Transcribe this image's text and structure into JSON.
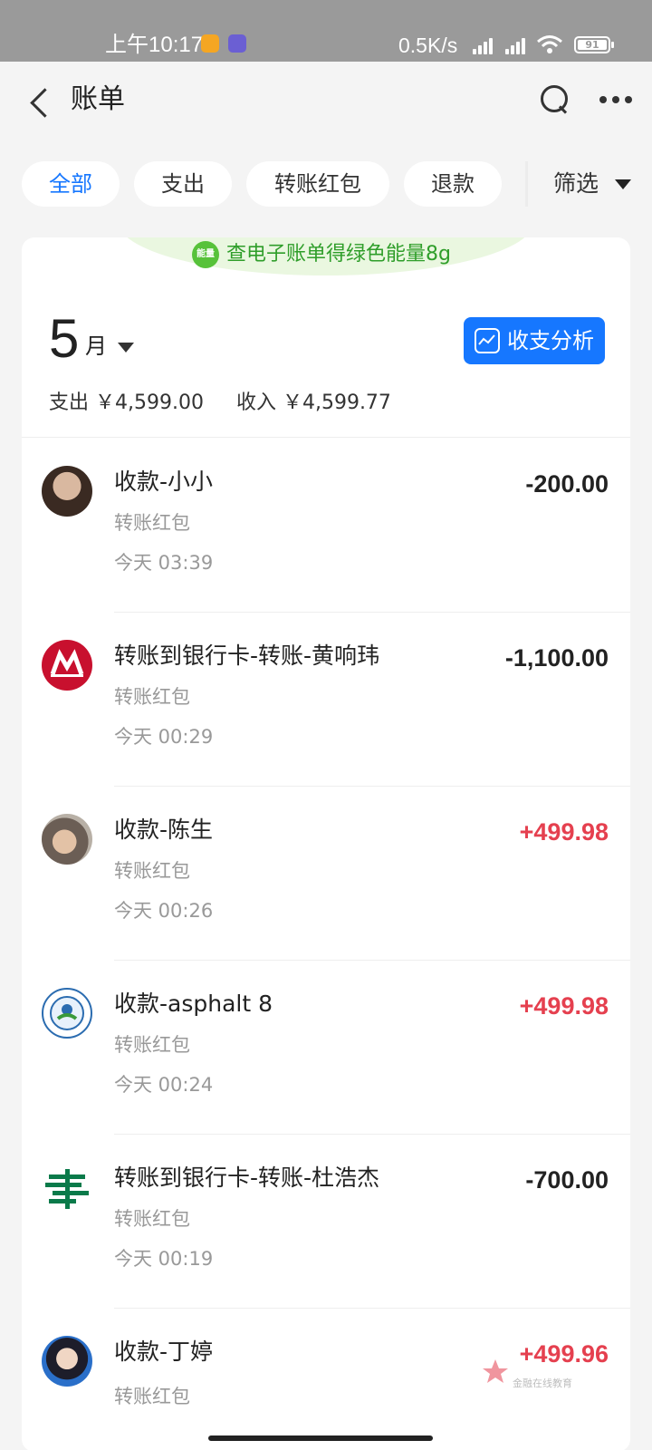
{
  "status_bar": {
    "time": "上午10:17",
    "speed": "0.5K/s",
    "battery": "91"
  },
  "header": {
    "title": "账单"
  },
  "filters": {
    "chips": [
      "全部",
      "支出",
      "转账红包",
      "退款"
    ],
    "active": "全部",
    "filter_label": "筛选"
  },
  "banner": {
    "badge": "能量",
    "text": "查电子账单得绿色能量8g"
  },
  "month": {
    "number": "5",
    "unit": "月",
    "analysis_label": "收支分析",
    "expense": "支出 ￥4,599.00",
    "income": "收入 ￥4,599.77"
  },
  "transactions": [
    {
      "name": "收款-小小",
      "category": "转账红包",
      "time": "今天 03:39",
      "amount": "-200.00",
      "positive": false,
      "avatar": "photo-avatar"
    },
    {
      "name": "转账到银行卡-转账-黄响玮",
      "category": "转账红包",
      "time": "今天 00:29",
      "amount": "-1,100.00",
      "positive": false,
      "avatar": "cmb-bank-logo"
    },
    {
      "name": "收款-陈生",
      "category": "转账红包",
      "time": "今天 00:26",
      "amount": "+499.98",
      "positive": true,
      "avatar": "photo-avatar"
    },
    {
      "name": "收款-asphalt 8",
      "category": "转账红包",
      "time": "今天 00:24",
      "amount": "+499.98",
      "positive": true,
      "avatar": "epa-seal-avatar"
    },
    {
      "name": "转账到银行卡-转账-杜浩杰",
      "category": "转账红包",
      "time": "今天 00:19",
      "amount": "-700.00",
      "positive": false,
      "avatar": "postal-bank-logo"
    },
    {
      "name": "收款-丁婷",
      "category": "转账红包",
      "time": "",
      "amount": "+499.96",
      "positive": true,
      "avatar": "photo-avatar"
    }
  ],
  "watermark": {
    "text": "金融在线教育"
  },
  "colors": {
    "accent": "#1677ff",
    "positive_amount": "#e5404f",
    "energy_green": "#2f9e2a"
  }
}
